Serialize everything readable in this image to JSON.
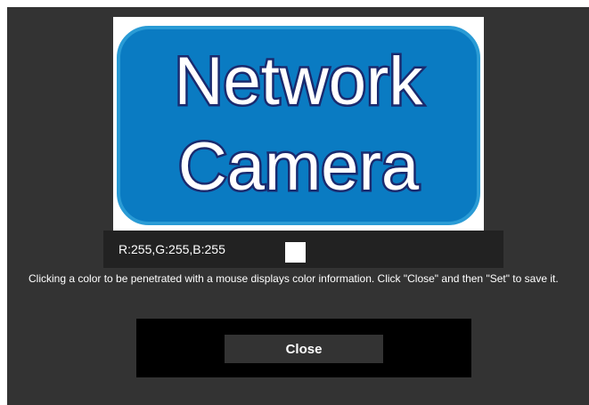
{
  "preview": {
    "logo_line1": "Network",
    "logo_line2": "Camera",
    "logo_bg_color": "#0a7bc2",
    "logo_text_color": "#ffffff",
    "logo_outline_color": "#1a2a6e",
    "logo_border_color": "#2a9bd5"
  },
  "color_info": {
    "rgb_text": "R:255,G:255,B:255",
    "swatch_color": "#ffffff"
  },
  "instructions": "Clicking a color to be penetrated with a mouse displays color information. Click \"Close\" and then \"Set\" to save it.",
  "buttons": {
    "close_label": "Close"
  }
}
